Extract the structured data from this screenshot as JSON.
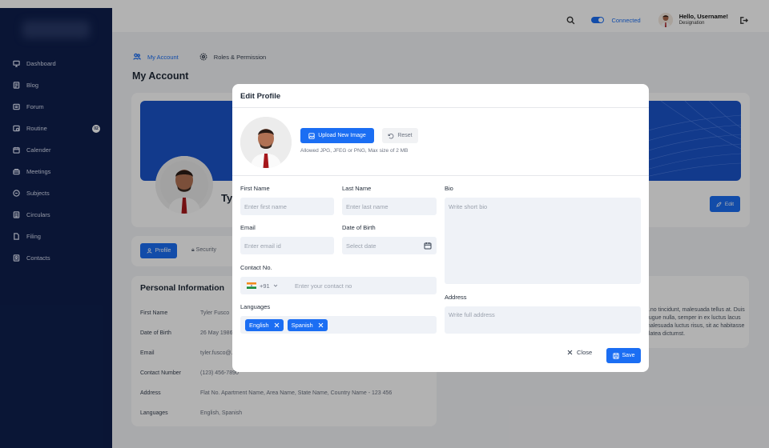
{
  "sidebar": {
    "items": [
      {
        "label": "Dashboard",
        "icon": "monitor-icon"
      },
      {
        "label": "Blog",
        "icon": "blog-icon"
      },
      {
        "label": "Forum",
        "icon": "forum-icon"
      },
      {
        "label": "Routine",
        "icon": "routine-icon",
        "badge": "02"
      },
      {
        "label": "Calender",
        "icon": "calendar-icon"
      },
      {
        "label": "Meetings",
        "icon": "meetings-icon"
      },
      {
        "label": "Subjects",
        "icon": "subjects-icon"
      },
      {
        "label": "Circulars",
        "icon": "circulars-icon"
      },
      {
        "label": "Filing",
        "icon": "file-icon"
      },
      {
        "label": "Contacts",
        "icon": "contacts-icon"
      }
    ]
  },
  "topbar": {
    "status": "Connected",
    "greeting": "Hello, Username!",
    "designation": "Designation"
  },
  "page": {
    "tabs": [
      "My Account",
      "Roles & Permission"
    ],
    "title": "My Account",
    "name_partial": "Ty",
    "edit_label": "Edit",
    "sub_tabs": [
      "Profile",
      "Security"
    ]
  },
  "personal_info": {
    "title": "Personal Information",
    "rows": [
      {
        "label": "First Name",
        "value": "Tyler Fusco"
      },
      {
        "label": "Date of Birth",
        "value": "26 May 1986"
      },
      {
        "label": "Email",
        "value": "tyler.fusco@..."
      },
      {
        "label": "Contact Number",
        "value": "(123) 456-7890"
      },
      {
        "label": "Address",
        "value": "Flat No. Apartment Name, Area Name, State Name, Country Name - 123 456"
      },
      {
        "label": "Languages",
        "value": "English, Spanish"
      }
    ]
  },
  "bio_bg": "...no tincidunt, malesuada tellus at. Duis augue nulla, semper in ex luctus lacus malesuada luctus risus, sit ac habitasse platea dictumst.",
  "modal": {
    "title": "Edit Profile",
    "upload_label": "Upload New Image",
    "reset_label": "Reset",
    "hint": "Allowed JPG, JFEG or PNG, Max size of 2 MB",
    "first_name": {
      "label": "First Name",
      "placeholder": "Enter first name"
    },
    "last_name": {
      "label": "Last Name",
      "placeholder": "Enter last name"
    },
    "email": {
      "label": "Email",
      "placeholder": "Enter email id"
    },
    "dob": {
      "label": "Date of Birth",
      "placeholder": "Select date"
    },
    "contact": {
      "label": "Contact No.",
      "prefix": "+91",
      "placeholder": "Enter your contact no"
    },
    "languages": {
      "label": "Languages",
      "tags": [
        "English",
        "Spanish"
      ]
    },
    "bio": {
      "label": "Bio",
      "placeholder": "Write short bio"
    },
    "address": {
      "label": "Address",
      "placeholder": "Write full address"
    },
    "close_label": "Close",
    "save_label": "Save"
  },
  "colors": {
    "primary": "#1b6ef3",
    "sidebar": "#0f1f4d",
    "banner": "#1b54c9"
  }
}
